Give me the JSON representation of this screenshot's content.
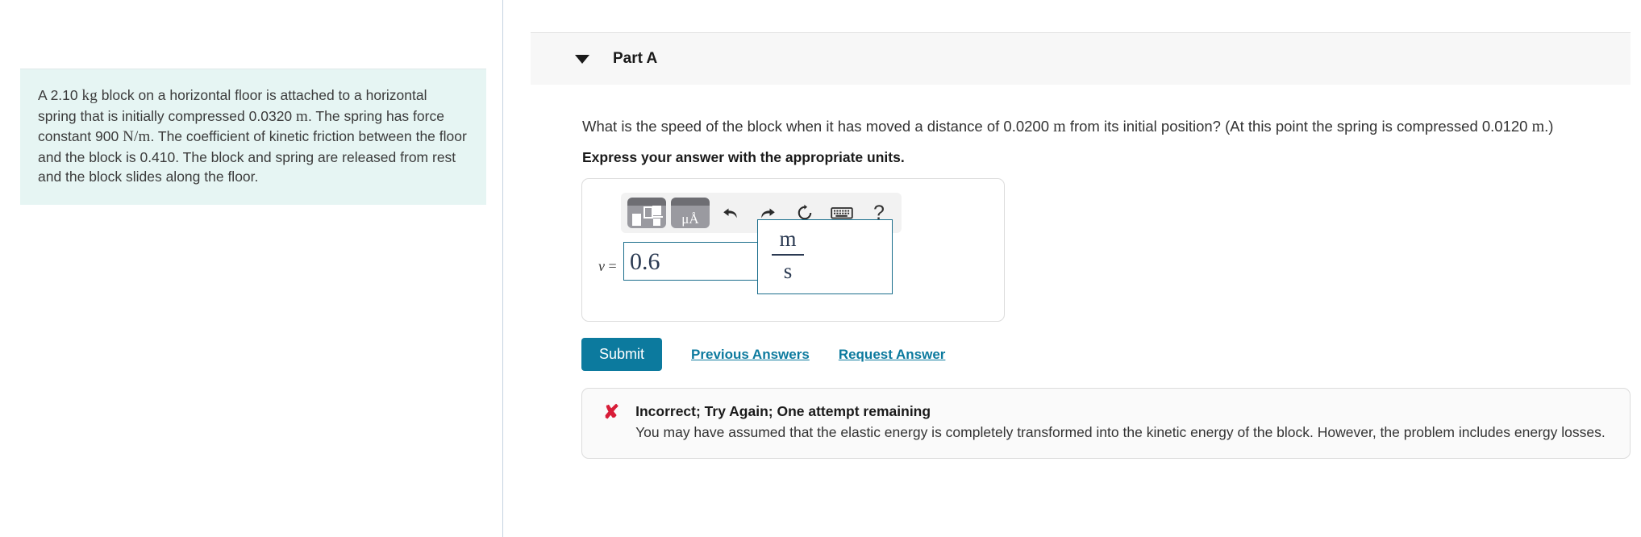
{
  "problem": {
    "text_parts": [
      {
        "t": "A 2.10 ",
        "math": false
      },
      {
        "t": "kg",
        "math": true
      },
      {
        "t": " block on a horizontal floor is attached to a horizontal spring that is initially compressed 0.0320 ",
        "math": false
      },
      {
        "t": "m",
        "math": true
      },
      {
        "t": ". The spring has force constant 900 ",
        "math": false
      },
      {
        "t": "N/m",
        "math": true
      },
      {
        "t": ". The coefficient of kinetic friction between the floor and the block is 0.410. The block and spring are released from rest and the block slides along the floor.",
        "math": false
      }
    ],
    "full_text": "A 2.10 kg block on a horizontal floor is attached to a horizontal spring that is initially compressed 0.0320 m. The spring has force constant 900 N/m. The coefficient of kinetic friction between the floor and the block is 0.410. The block and spring are released from rest and the block slides along the floor.",
    "background_color": "#e6f5f3",
    "values": {
      "mass_kg": "2.10",
      "initial_compression_m": "0.0320",
      "force_constant_N_per_m": "900",
      "kinetic_friction_coefficient": "0.410"
    }
  },
  "part": {
    "title": "Part A",
    "caret_icon": "chevron-down-icon",
    "question_lead": "What is the speed of the block when it has moved a distance of 0.0200 ",
    "question_unit_1": "m",
    "question_mid": " from its initial position? (At this point the spring is compressed 0.0120 ",
    "question_unit_2": "m",
    "question_tail": ".)",
    "question_full": "What is the speed of the block when it has moved a distance of 0.0200 m from its initial position? (At this point the spring is compressed 0.0120 m.)",
    "instruction": "Express your answer with the appropriate units."
  },
  "toolbar": {
    "tiles": [
      {
        "name": "math-template-icon",
        "label": ""
      },
      {
        "name": "units-icon",
        "label": "μÅ"
      }
    ],
    "icons": [
      {
        "name": "undo-icon",
        "label": "undo"
      },
      {
        "name": "redo-icon",
        "label": "redo"
      },
      {
        "name": "reset-icon",
        "label": "reset"
      },
      {
        "name": "keyboard-icon",
        "label": "keyboard"
      },
      {
        "name": "help-icon",
        "label": "?"
      }
    ],
    "help_glyph": "?"
  },
  "answer": {
    "variable": "v",
    "equals": "=",
    "value": "0.6",
    "value_placeholder": "",
    "units_numerator": "m",
    "units_denominator": "s",
    "field_border_color": "#1b6e8c"
  },
  "actions": {
    "submit_label": "Submit",
    "previous_answers_label": "Previous Answers",
    "request_answer_label": "Request Answer",
    "submit_color": "#0c7a9e",
    "link_color": "#0c7a9e"
  },
  "feedback": {
    "icon": "x-mark-icon",
    "icon_glyph": "✘",
    "icon_color": "#d81d38",
    "title": "Incorrect; Try Again; One attempt remaining",
    "detail": "You may have assumed that the elastic energy is completely transformed into the kinetic energy of the block. However, the problem includes energy losses."
  }
}
